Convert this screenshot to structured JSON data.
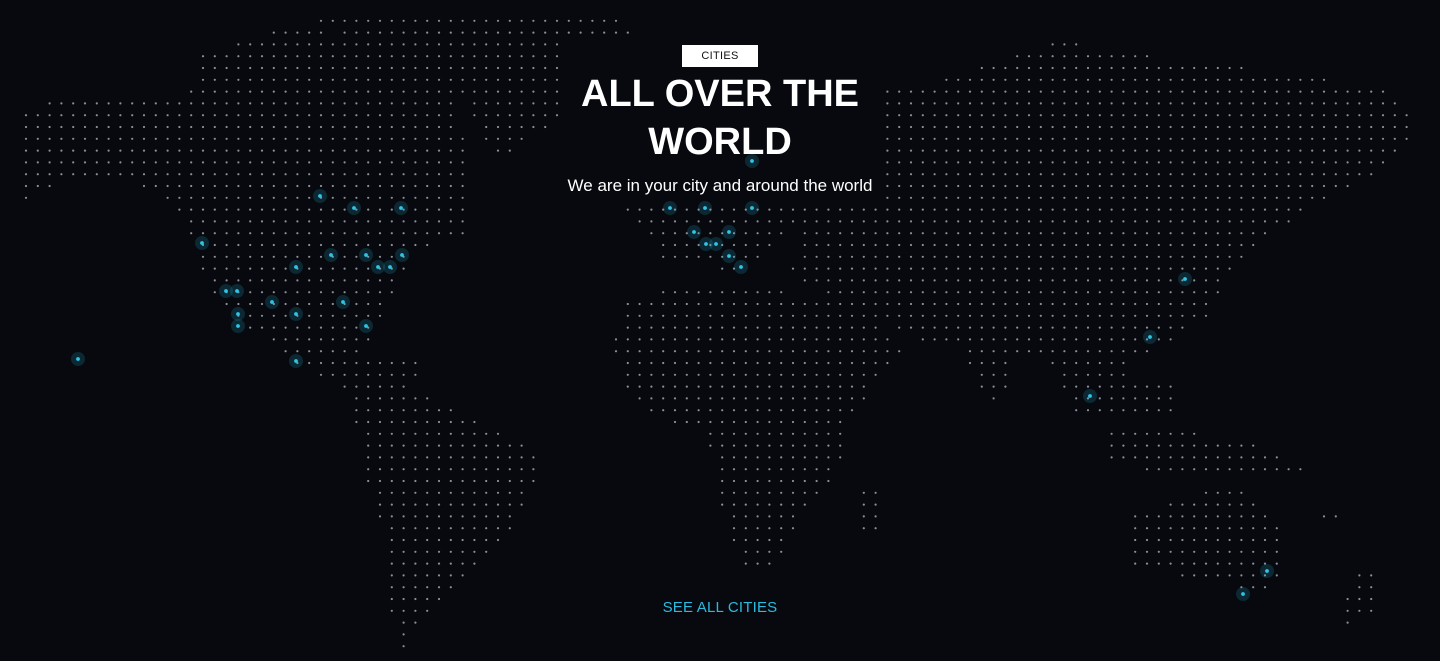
{
  "hero": {
    "tag_label": "CITIES",
    "headline_line1": "ALL OVER THE",
    "headline_line2": "WORLD",
    "subtitle": "We are in your city and around the world",
    "cta_label": "SEE ALL CITIES"
  },
  "colors": {
    "background": "#07090f",
    "map_dot": "#8c8f96",
    "city_highlight": "#2ec4e6",
    "cta": "#2bbbe0",
    "tag_background": "#ffffff",
    "text": "#ffffff"
  },
  "map": {
    "style": "dotted world map",
    "highlighted_city_count": 41
  }
}
